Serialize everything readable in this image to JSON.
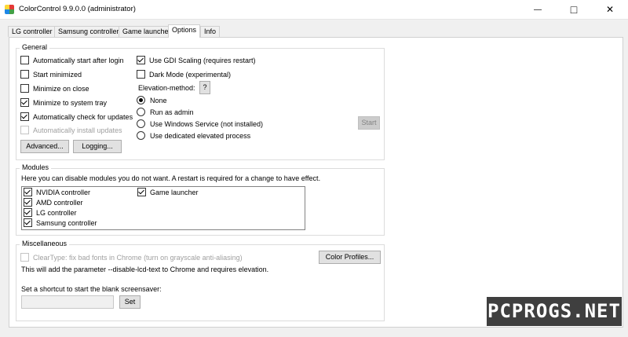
{
  "window": {
    "title": "ColorControl 9.9.0.0 (administrator)",
    "minimize_glyph": "—",
    "maximize_glyph": "□",
    "close_glyph": "✕"
  },
  "tabs": [
    {
      "label": "LG controller"
    },
    {
      "label": "Samsung controller"
    },
    {
      "label": "Game launcher"
    },
    {
      "label": "Options",
      "active": true
    },
    {
      "label": "Info"
    }
  ],
  "general": {
    "title": "General",
    "auto_start": {
      "label": "Automatically start after login",
      "checked": false
    },
    "start_minimized": {
      "label": "Start minimized",
      "checked": false
    },
    "minimize_on_close": {
      "label": "Minimize on close",
      "checked": false
    },
    "minimize_to_tray": {
      "label": "Minimize to system tray",
      "checked": true
    },
    "auto_check_updates": {
      "label": "Automatically check for updates",
      "checked": true
    },
    "auto_install_updates": {
      "label": "Automatically install updates",
      "checked": false,
      "disabled": true
    },
    "gdi_scaling": {
      "label": "Use GDI Scaling (requires restart)",
      "checked": true
    },
    "dark_mode": {
      "label": "Dark Mode (experimental)",
      "checked": false
    },
    "elevation_label": "Elevation-method:",
    "elevation_help": "?",
    "elevation_options": [
      {
        "label": "None",
        "selected": true
      },
      {
        "label": "Run as admin",
        "selected": false
      },
      {
        "label": "Use Windows Service (not installed)",
        "selected": false
      },
      {
        "label": "Use dedicated elevated process",
        "selected": false
      }
    ],
    "start_button": "Start",
    "advanced_button": "Advanced...",
    "logging_button": "Logging..."
  },
  "modules": {
    "title": "Modules",
    "description": "Here you can disable modules you do not want. A restart is required for a change to have effect.",
    "items": [
      {
        "label": "NVIDIA controller",
        "checked": true
      },
      {
        "label": "AMD controller",
        "checked": true
      },
      {
        "label": "LG controller",
        "checked": true
      },
      {
        "label": "Samsung controller",
        "checked": true
      },
      {
        "label": "Game launcher",
        "checked": true
      }
    ]
  },
  "misc": {
    "title": "Miscellaneous",
    "cleartype": {
      "label": "ClearType: fix bad fonts in Chrome (turn on grayscale anti-aliasing)",
      "checked": false,
      "disabled": true
    },
    "color_profiles_button": "Color Profiles...",
    "note": "This will add the parameter --disable-lcd-text to Chrome and requires elevation.",
    "shortcut_label": "Set a shortcut to start the blank screensaver:",
    "shortcut_value": "",
    "set_button": "Set"
  },
  "watermark": "PCPROGS.NET",
  "colors": {
    "accent": "#0078d7",
    "window_bg": "#f0f0f0",
    "panel_bg": "#ffffff"
  }
}
